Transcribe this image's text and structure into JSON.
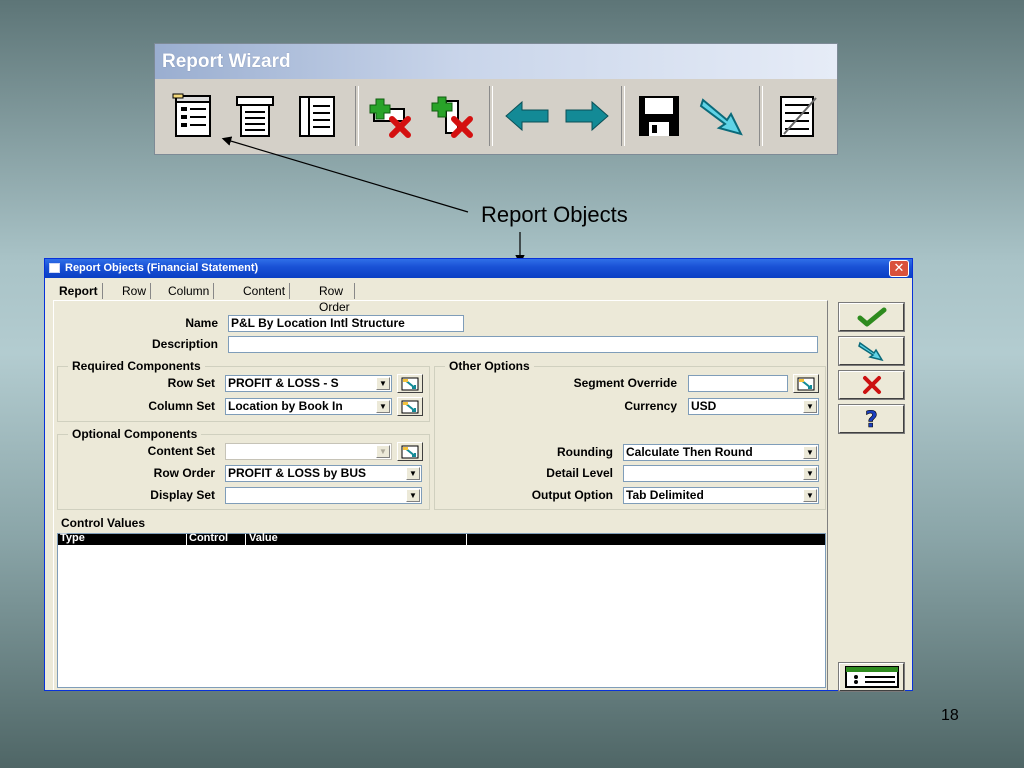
{
  "toolbar": {
    "title": "Report Wizard",
    "buttons": [
      {
        "icon": "report-objects-icon"
      },
      {
        "icon": "report-layout-icon"
      },
      {
        "icon": "report-document-icon"
      },
      {
        "icon": "add-row-delete-icon"
      },
      {
        "icon": "add-column-delete-icon"
      },
      {
        "icon": "arrow-left-icon"
      },
      {
        "icon": "arrow-right-icon"
      },
      {
        "icon": "save-disk-icon"
      },
      {
        "icon": "run-report-arrow-icon"
      },
      {
        "icon": "report-notes-icon"
      }
    ]
  },
  "annotation": {
    "label": "Report Objects"
  },
  "dialog": {
    "title": "Report Objects (Financial Statement)",
    "close": "✕",
    "tabs": [
      "Report",
      "Row",
      "Column",
      "Content",
      "Row Order"
    ],
    "name_label": "Name",
    "name_value": "P&L By Location Intl Structure",
    "description_label": "Description",
    "description_value": "",
    "required_components": {
      "title": "Required Components",
      "row_set_label": "Row Set",
      "row_set_value": "PROFIT & LOSS - S",
      "column_set_label": "Column Set",
      "column_set_value": "Location by Book In"
    },
    "optional_components": {
      "title": "Optional Components",
      "content_set_label": "Content Set",
      "content_set_value": "",
      "row_order_label": "Row Order",
      "row_order_value": "PROFIT & LOSS by BUS",
      "display_set_label": "Display Set",
      "display_set_value": ""
    },
    "other_options": {
      "title": "Other Options",
      "segment_override_label": "Segment Override",
      "segment_override_value": "",
      "currency_label": "Currency",
      "currency_value": "USD",
      "rounding_label": "Rounding",
      "rounding_value": "Calculate Then Round",
      "detail_level_label": "Detail Level",
      "detail_level_value": "",
      "output_option_label": "Output Option",
      "output_option_value": "Tab Delimited"
    },
    "control_values": {
      "title": "Control Values",
      "columns": [
        "Type",
        "Control",
        "Value"
      ],
      "rows": []
    },
    "side_buttons": [
      "ok-check-icon",
      "run-arrow-icon",
      "cancel-x-icon",
      "help-question-icon"
    ]
  },
  "page_number": "18",
  "colors": {
    "titlebar": "#0a3fc4",
    "dialog_bg": "#ece9d8",
    "toolbar_bg": "#d4d0c8",
    "check_green": "#2e8b1e",
    "cancel_red": "#cc1111",
    "arrow_teal": "#138a96"
  }
}
